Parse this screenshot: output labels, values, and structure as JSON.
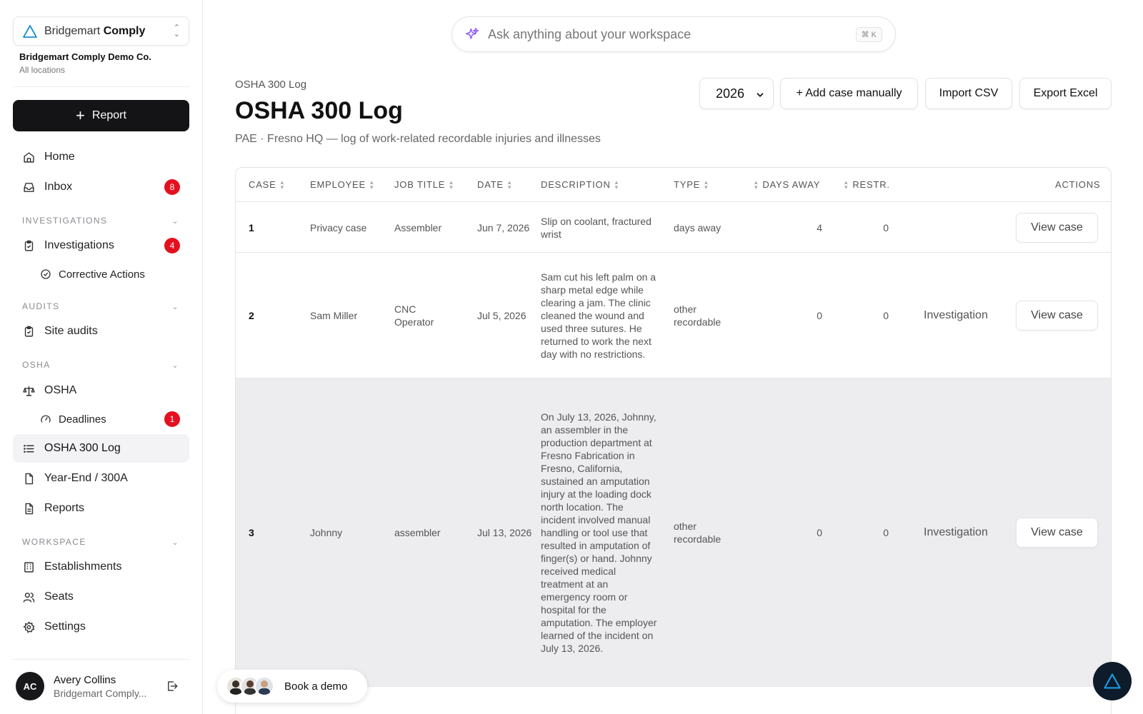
{
  "app": {
    "brand_light": "Bridgemart",
    "brand_bold": "Comply",
    "company_name": "Bridgemart Comply Demo Co.",
    "company_scope": "All locations",
    "report_label": "Report"
  },
  "sidebar": {
    "home": "Home",
    "inbox": "Inbox",
    "inbox_count": "8",
    "sections": {
      "investigations": "INVESTIGATIONS",
      "audits": "AUDITS",
      "osha": "OSHA",
      "workspace": "WORKSPACE"
    },
    "investigations": "Investigations",
    "investigations_count": "4",
    "corrective_actions": "Corrective Actions",
    "site_audits": "Site audits",
    "osha": "OSHA",
    "deadlines": "Deadlines",
    "deadlines_count": "1",
    "osha_300_log": "OSHA 300 Log",
    "year_end": "Year-End / 300A",
    "reports": "Reports",
    "establishments": "Establishments",
    "seats": "Seats",
    "settings": "Settings"
  },
  "user": {
    "initials": "AC",
    "name": "Avery Collins",
    "company": "Bridgemart Comply..."
  },
  "search": {
    "placeholder": "Ask anything about your workspace",
    "shortcut": "⌘ K"
  },
  "page": {
    "breadcrumb": "OSHA 300 Log",
    "title": "OSHA 300 Log",
    "subtitle": "PAE · Fresno HQ — log of work-related recordable injuries and illnesses"
  },
  "toolbar": {
    "year": "2026",
    "add_case": "+ Add case manually",
    "import_csv": "Import CSV",
    "export_excel": "Export Excel"
  },
  "table": {
    "headers": {
      "case": "CASE",
      "employee": "EMPLOYEE",
      "job_title": "JOB TITLE",
      "date": "DATE",
      "description": "DESCRIPTION",
      "type": "TYPE",
      "days_away": "DAYS AWAY",
      "restr": "RESTR.",
      "actions": "ACTIONS"
    },
    "view_label": "View case",
    "rows": [
      {
        "case": "1",
        "employee": "Privacy case",
        "job_title": "Assembler",
        "date": "Jun 7, 2026",
        "description": "Slip on coolant, fractured wrist",
        "type": "days away",
        "days_away": "4",
        "restr": "0",
        "link": ""
      },
      {
        "case": "2",
        "employee": "Sam Miller",
        "job_title": "CNC Operator",
        "date": "Jul 5, 2026",
        "description": "Sam cut his left palm on a sharp metal edge while clearing a jam. The clinic cleaned the wound and used three sutures. He returned to work the next day with no restrictions.",
        "type": "other recordable",
        "days_away": "0",
        "restr": "0",
        "link": "Investigation"
      },
      {
        "case": "3",
        "employee": "Johnny",
        "job_title": "assembler",
        "date": "Jul 13, 2026",
        "description": "On July 13, 2026, Johnny, an assembler in the production department at Fresno Fabrication in Fresno, California, sustained an amputation injury at the loading dock north location. The incident involved manual handling or tool use that resulted in amputation of finger(s) or hand. Johnny received medical treatment at an emergency room or hospital for the amputation. The employer learned of the incident on July 13, 2026.",
        "type": "other recordable",
        "days_away": "0",
        "restr": "0",
        "link": "Investigation"
      }
    ]
  },
  "demo": {
    "label": "Book a demo"
  },
  "colors": {
    "badge": "#e5101f",
    "primary": "#141416",
    "hover_row": "#ededf0",
    "active_nav": "#f3f3f5",
    "fab": "#0d1b2a"
  }
}
